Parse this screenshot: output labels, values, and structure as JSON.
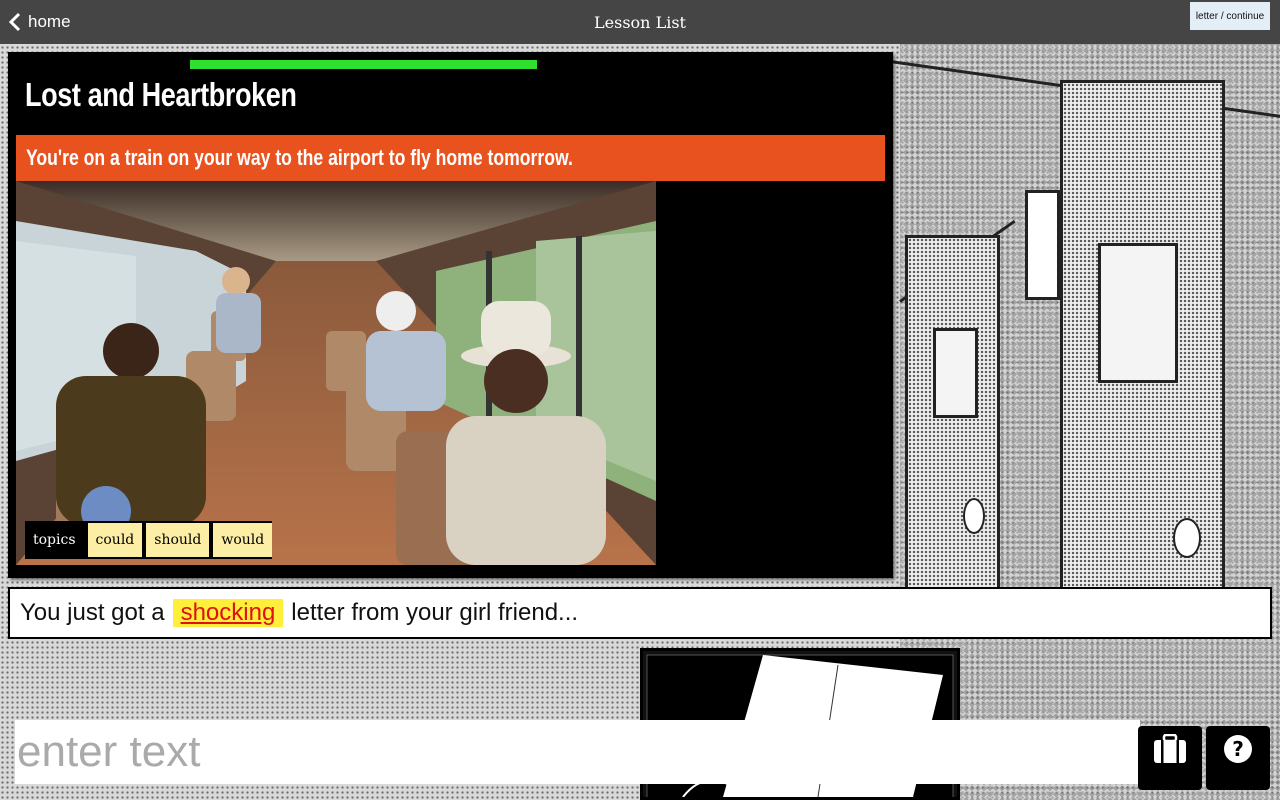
{
  "topbar": {
    "home_label": "home",
    "title": "Lesson List",
    "letter_button": "letter / continue"
  },
  "lesson": {
    "title": "Lost and Heartbroken",
    "progress_fraction": 0.35,
    "progress_color": "#2fe02f",
    "banner": "You're on a train on your way to the airport to fly home tomorrow.",
    "banner_color": "#e8521e",
    "topics_label": "topics",
    "topics": [
      "could",
      "should",
      "would"
    ]
  },
  "sentence": {
    "before": "You just got a",
    "vocab": "shocking",
    "after": "letter from your girl friend..."
  },
  "entry": {
    "placeholder": "enter text",
    "value": ""
  },
  "icons": {
    "suitcase": "suitcase-icon",
    "help": "help-icon"
  }
}
